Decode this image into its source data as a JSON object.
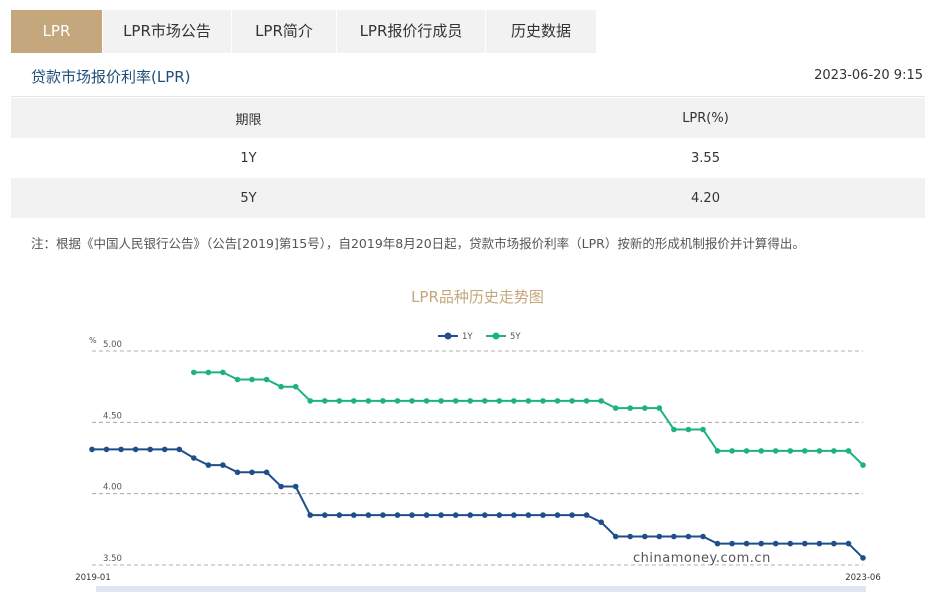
{
  "tabs": [
    "LPR",
    "LPR市场公告",
    "LPR简介",
    "LPR报价行成员",
    "历史数据"
  ],
  "section_title": "贷款市场报价利率(LPR)",
  "timestamp": "2023-06-20 9:15",
  "table": {
    "headers": [
      "期限",
      "LPR(%)"
    ],
    "rows": [
      [
        "1Y",
        "3.55"
      ],
      [
        "5Y",
        "4.20"
      ]
    ]
  },
  "note": "注：根据《中国人民银行公告》（公告[2019]第15号），自2019年8月20日起，贷款市场报价利率（LPR）按新的形成机制报价并计算得出。",
  "chart_title": "LPR品种历史走势图",
  "watermark": "chinamoney.com.cn",
  "colors": {
    "accent": "#c4a77d",
    "series_1y": "#1f4e8a",
    "series_5y": "#1db37b",
    "title_blue": "#1f4e79"
  },
  "chart_data": {
    "type": "line",
    "title": "LPR品种历史走势图",
    "ylabel": "%",
    "ylim": [
      3.5,
      5.0
    ],
    "yticks": [
      "5.00",
      "4.50",
      "4.00",
      "3.50"
    ],
    "x_start_label": "2019-01",
    "x_end_label": "2023-06",
    "legend_position": "top-center",
    "grid": "horizontal-dashed",
    "series": [
      {
        "name": "1Y",
        "color": "#1f4e8a",
        "values": [
          4.31,
          4.31,
          4.31,
          4.31,
          4.31,
          4.31,
          4.31,
          4.25,
          4.2,
          4.2,
          4.15,
          4.15,
          4.15,
          4.05,
          4.05,
          3.85,
          3.85,
          3.85,
          3.85,
          3.85,
          3.85,
          3.85,
          3.85,
          3.85,
          3.85,
          3.85,
          3.85,
          3.85,
          3.85,
          3.85,
          3.85,
          3.85,
          3.85,
          3.85,
          3.85,
          3.8,
          3.7,
          3.7,
          3.7,
          3.7,
          3.7,
          3.7,
          3.7,
          3.65,
          3.65,
          3.65,
          3.65,
          3.65,
          3.65,
          3.65,
          3.65,
          3.65,
          3.65,
          3.55
        ]
      },
      {
        "name": "5Y",
        "color": "#1db37b",
        "values": [
          null,
          null,
          null,
          null,
          null,
          null,
          null,
          4.85,
          4.85,
          4.85,
          4.8,
          4.8,
          4.8,
          4.75,
          4.75,
          4.65,
          4.65,
          4.65,
          4.65,
          4.65,
          4.65,
          4.65,
          4.65,
          4.65,
          4.65,
          4.65,
          4.65,
          4.65,
          4.65,
          4.65,
          4.65,
          4.65,
          4.65,
          4.65,
          4.65,
          4.65,
          4.6,
          4.6,
          4.6,
          4.6,
          4.45,
          4.45,
          4.45,
          4.3,
          4.3,
          4.3,
          4.3,
          4.3,
          4.3,
          4.3,
          4.3,
          4.3,
          4.3,
          4.2
        ]
      }
    ]
  }
}
